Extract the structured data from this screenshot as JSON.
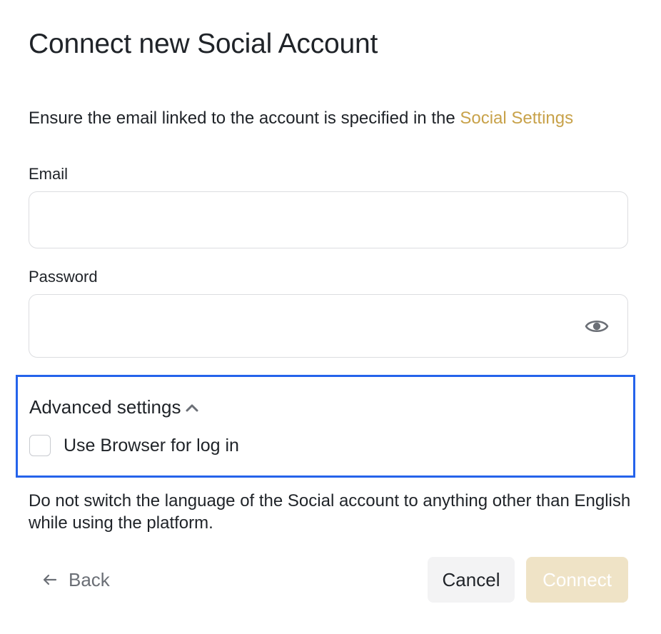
{
  "dialog": {
    "title": "Connect new Social Account",
    "notice": {
      "text": "Ensure the email linked to the account is specified in the ",
      "link_text": "Social Settings"
    },
    "email": {
      "label": "Email",
      "value": "",
      "placeholder": ""
    },
    "password": {
      "label": "Password",
      "value": "",
      "placeholder": "",
      "toggle_icon": "eye-icon"
    },
    "advanced": {
      "title": "Advanced settings",
      "expanded_icon": "chevron-up-icon",
      "use_browser": {
        "label": "Use Browser for log in",
        "checked": false
      }
    },
    "warning": "Do not switch the language of the Social account to anything other than English while using the platform.",
    "actions": {
      "back_label": "Back",
      "back_icon": "arrow-left-icon",
      "cancel_label": "Cancel",
      "connect_label": "Connect"
    }
  },
  "colors": {
    "link": "#c8a24a",
    "highlight_border": "#2563eb",
    "connect_disabled_bg": "#efe3c6",
    "cancel_bg": "#f3f3f4",
    "input_border": "#dcdde0"
  }
}
